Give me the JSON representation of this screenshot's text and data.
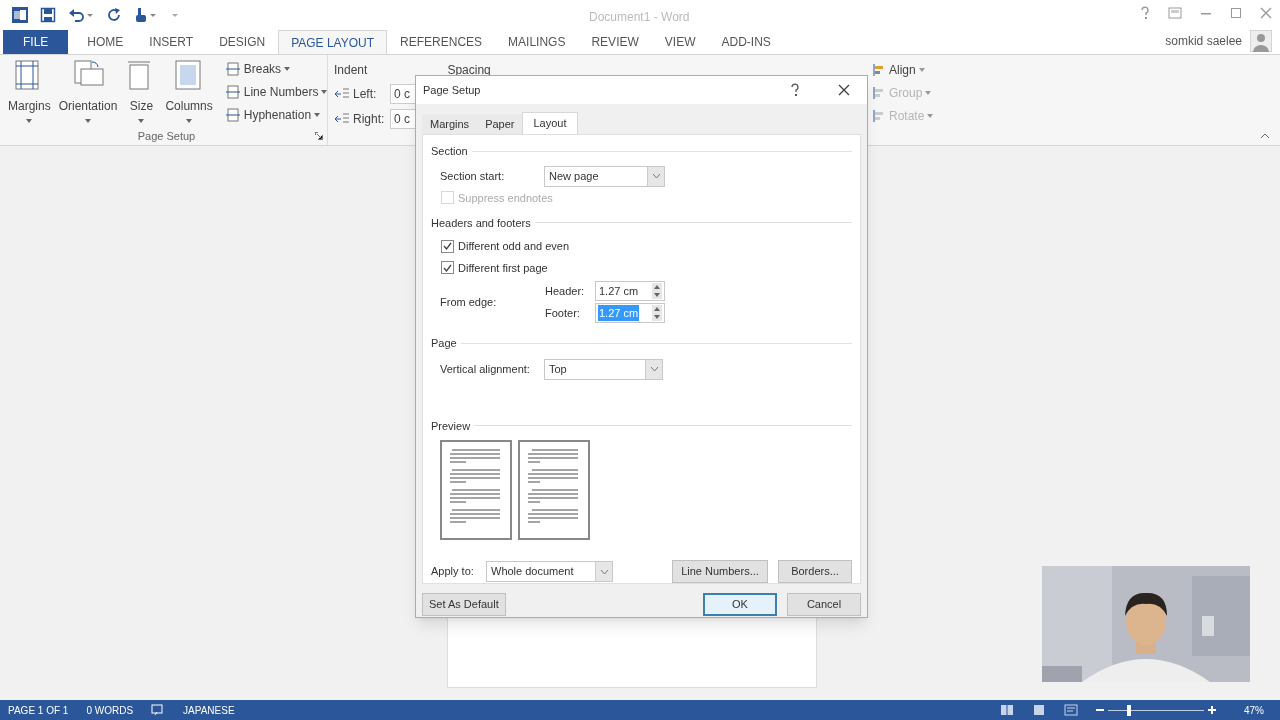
{
  "window": {
    "title": "Document1 - Word",
    "user": "somkid saelee"
  },
  "ribbon_tabs": [
    {
      "label": "FILE",
      "kind": "file",
      "selected": false
    },
    {
      "label": "HOME",
      "kind": "tab",
      "selected": false
    },
    {
      "label": "INSERT",
      "kind": "tab",
      "selected": false
    },
    {
      "label": "DESIGN",
      "kind": "tab",
      "selected": false
    },
    {
      "label": "PAGE LAYOUT",
      "kind": "tab",
      "selected": true
    },
    {
      "label": "REFERENCES",
      "kind": "tab",
      "selected": false
    },
    {
      "label": "MAILINGS",
      "kind": "tab",
      "selected": false
    },
    {
      "label": "REVIEW",
      "kind": "tab",
      "selected": false
    },
    {
      "label": "VIEW",
      "kind": "tab",
      "selected": false
    },
    {
      "label": "ADD-INS",
      "kind": "tab",
      "selected": false
    }
  ],
  "ribbon": {
    "page_setup": {
      "label": "Page Setup",
      "large_buttons": [
        "Margins",
        "Orientation",
        "Size",
        "Columns"
      ],
      "small_buttons": [
        "Breaks",
        "Line Numbers",
        "Hyphenation"
      ]
    },
    "paragraph": {
      "indent_label": "Indent",
      "left_label": "Left:",
      "left_value": "0 c",
      "right_label": "Right:",
      "right_value": "0 c",
      "spacing_label": "Spacing"
    },
    "arrange": [
      {
        "label": "Align",
        "disabled": false
      },
      {
        "label": "Group",
        "disabled": true
      },
      {
        "label": "Rotate",
        "disabled": true
      }
    ]
  },
  "dialog": {
    "title": "Page Setup",
    "tabs": [
      {
        "label": "Margins",
        "selected": false
      },
      {
        "label": "Paper",
        "selected": false
      },
      {
        "label": "Layout",
        "selected": true
      }
    ],
    "section": {
      "heading": "Section",
      "start_label": "Section start:",
      "start_value": "New page",
      "suppress": {
        "label": "Suppress endnotes",
        "checked": false,
        "disabled": true
      }
    },
    "headers_footers": {
      "heading": "Headers and footers",
      "options": [
        {
          "label": "Different odd and even",
          "checked": true,
          "disabled": false
        },
        {
          "label": "Different first page",
          "checked": true,
          "disabled": false
        }
      ],
      "from_edge_label": "From edge:",
      "header_label": "Header:",
      "header_value": "1.27 cm",
      "footer_label": "Footer:",
      "footer_value": "1.27 cm",
      "footer_selected": true
    },
    "page": {
      "heading": "Page",
      "valign_label": "Vertical alignment:",
      "valign_value": "Top"
    },
    "preview": {
      "heading": "Preview"
    },
    "apply_label": "Apply to:",
    "apply_value": "Whole document",
    "buttons": [
      "Line Numbers...",
      "Borders..."
    ],
    "footer_buttons": [
      {
        "label": "Set As Default",
        "default": false
      },
      {
        "label": "OK",
        "default": true
      },
      {
        "label": "Cancel",
        "default": false
      }
    ]
  },
  "status_bar": {
    "page": "PAGE 1 OF 1",
    "words": "0 WORDS",
    "language": "JAPANESE",
    "zoom_slider": {
      "level": 0.22
    },
    "zoom": "47%"
  }
}
